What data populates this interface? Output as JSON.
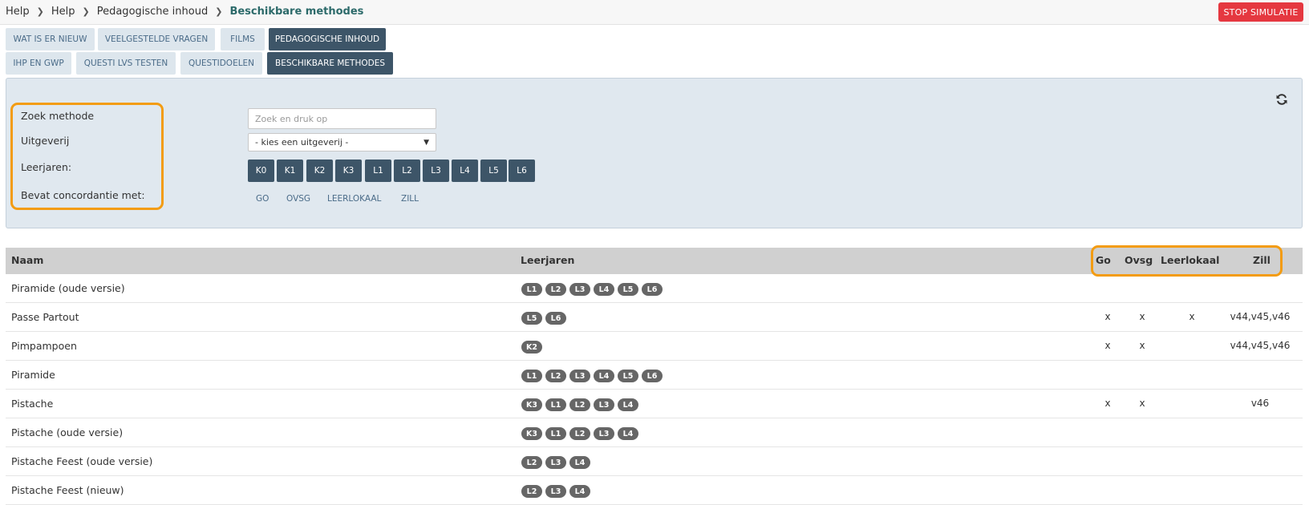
{
  "breadcrumb": {
    "items": [
      "Help",
      "Help",
      "Pedagogische inhoud"
    ],
    "current": "Beschikbare methodes"
  },
  "header": {
    "stop_label": "STOP SIMULATIE"
  },
  "tabs_row1": [
    {
      "label": "WAT IS ER NIEUW",
      "active": false
    },
    {
      "label": "VEELGESTELDE VRAGEN",
      "active": false
    },
    {
      "label": "FILMS",
      "active": false
    },
    {
      "label": "PEDAGOGISCHE INHOUD",
      "active": true
    }
  ],
  "tabs_row2": [
    {
      "label": "IHP EN GWP",
      "active": false
    },
    {
      "label": "QUESTI LVS TESTEN",
      "active": false
    },
    {
      "label": "QUESTIDOELEN",
      "active": false
    },
    {
      "label": "BESCHIKBARE METHODES",
      "active": true
    }
  ],
  "filters": {
    "search_label": "Zoek methode",
    "search_placeholder": "Zoek en druk op",
    "publisher_label": "Uitgeverij",
    "publisher_selected": "- kies een uitgeverij -",
    "grades_label": "Leerjaren:",
    "grades": [
      "K0",
      "K1",
      "K2",
      "K3",
      "L1",
      "L2",
      "L3",
      "L4",
      "L5",
      "L6"
    ],
    "concordance_label": "Bevat concordantie met:",
    "concordance_options": [
      "GO",
      "OVSG",
      "LEERLOKAAL",
      "ZILL"
    ]
  },
  "table": {
    "columns": {
      "name": "Naam",
      "grades": "Leerjaren",
      "go": "Go",
      "ovsg": "Ovsg",
      "leerlokaal": "Leerlokaal",
      "zill": "Zill"
    },
    "rows": [
      {
        "name": "Piramide (oude versie)",
        "grades": [
          "L1",
          "L2",
          "L3",
          "L4",
          "L5",
          "L6"
        ],
        "go": "",
        "ovsg": "",
        "leerlokaal": "",
        "zill": ""
      },
      {
        "name": "Passe Partout",
        "grades": [
          "L5",
          "L6"
        ],
        "go": "x",
        "ovsg": "x",
        "leerlokaal": "x",
        "zill": "v44,v45,v46"
      },
      {
        "name": "Pimpampoen",
        "grades": [
          "K2"
        ],
        "go": "x",
        "ovsg": "x",
        "leerlokaal": "",
        "zill": "v44,v45,v46"
      },
      {
        "name": "Piramide",
        "grades": [
          "L1",
          "L2",
          "L3",
          "L4",
          "L5",
          "L6"
        ],
        "go": "",
        "ovsg": "",
        "leerlokaal": "",
        "zill": ""
      },
      {
        "name": "Pistache",
        "grades": [
          "K3",
          "L1",
          "L2",
          "L3",
          "L4"
        ],
        "go": "x",
        "ovsg": "x",
        "leerlokaal": "",
        "zill": "v46"
      },
      {
        "name": "Pistache (oude versie)",
        "grades": [
          "K3",
          "L1",
          "L2",
          "L3",
          "L4"
        ],
        "go": "",
        "ovsg": "",
        "leerlokaal": "",
        "zill": ""
      },
      {
        "name": "Pistache Feest (oude versie)",
        "grades": [
          "L2",
          "L3",
          "L4"
        ],
        "go": "",
        "ovsg": "",
        "leerlokaal": "",
        "zill": ""
      },
      {
        "name": "Pistache Feest (nieuw)",
        "grades": [
          "L2",
          "L3",
          "L4"
        ],
        "go": "",
        "ovsg": "",
        "leerlokaal": "",
        "zill": ""
      }
    ]
  },
  "colors": {
    "accent": "#3d5568",
    "highlight": "#f39c12",
    "stop": "#e53840",
    "panel": "#e0e8ef"
  }
}
